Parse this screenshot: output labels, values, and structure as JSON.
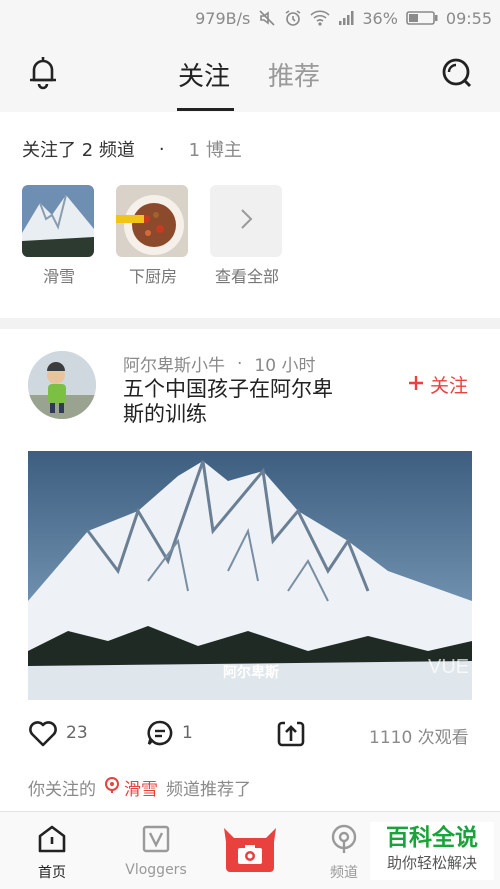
{
  "status_bar": {
    "speed": "979B/s",
    "battery": "36%",
    "time": "09:55"
  },
  "top_nav": {
    "tabs": [
      {
        "label": "关注",
        "active": true
      },
      {
        "label": "推荐",
        "active": false
      }
    ],
    "left_icon": "bell-icon",
    "right_icon": "search-icon"
  },
  "follow_panel": {
    "channels_text": "关注了 2 频道",
    "dot": "·",
    "bloggers_text": "1 博主",
    "channels": [
      {
        "label": "滑雪",
        "thumb": "snow-mountain"
      },
      {
        "label": "下厨房",
        "thumb": "food-plate"
      }
    ],
    "view_all_label": "查看全部"
  },
  "post": {
    "author": "阿尔卑斯小牛",
    "dot": "·",
    "time_ago": "10 小时",
    "title": "五个中国孩子在阿尔卑斯的训练",
    "follow_label": "关注",
    "video_caption": "阿尔卑斯",
    "video_watermark": "VUE",
    "likes": "23",
    "comments": "1",
    "views": "1110 次观看",
    "recommend_prefix": "你关注的",
    "recommend_channel": "滑雪",
    "recommend_suffix": "频道推荐了"
  },
  "bottom_bar": {
    "items": [
      {
        "label": "首页",
        "icon": "home-icon",
        "active": true
      },
      {
        "label": "Vloggers",
        "icon": "vloggers-icon",
        "active": false
      },
      {
        "label": "",
        "icon": "camera-icon",
        "active": false
      },
      {
        "label": "频道",
        "icon": "channel-icon",
        "active": false
      }
    ]
  },
  "watermark": {
    "line1": "百科全说",
    "line2": "助你轻松解决"
  },
  "colors": {
    "accent": "#e8413e",
    "active_text": "#222222",
    "muted_text": "#8a8a8a"
  }
}
